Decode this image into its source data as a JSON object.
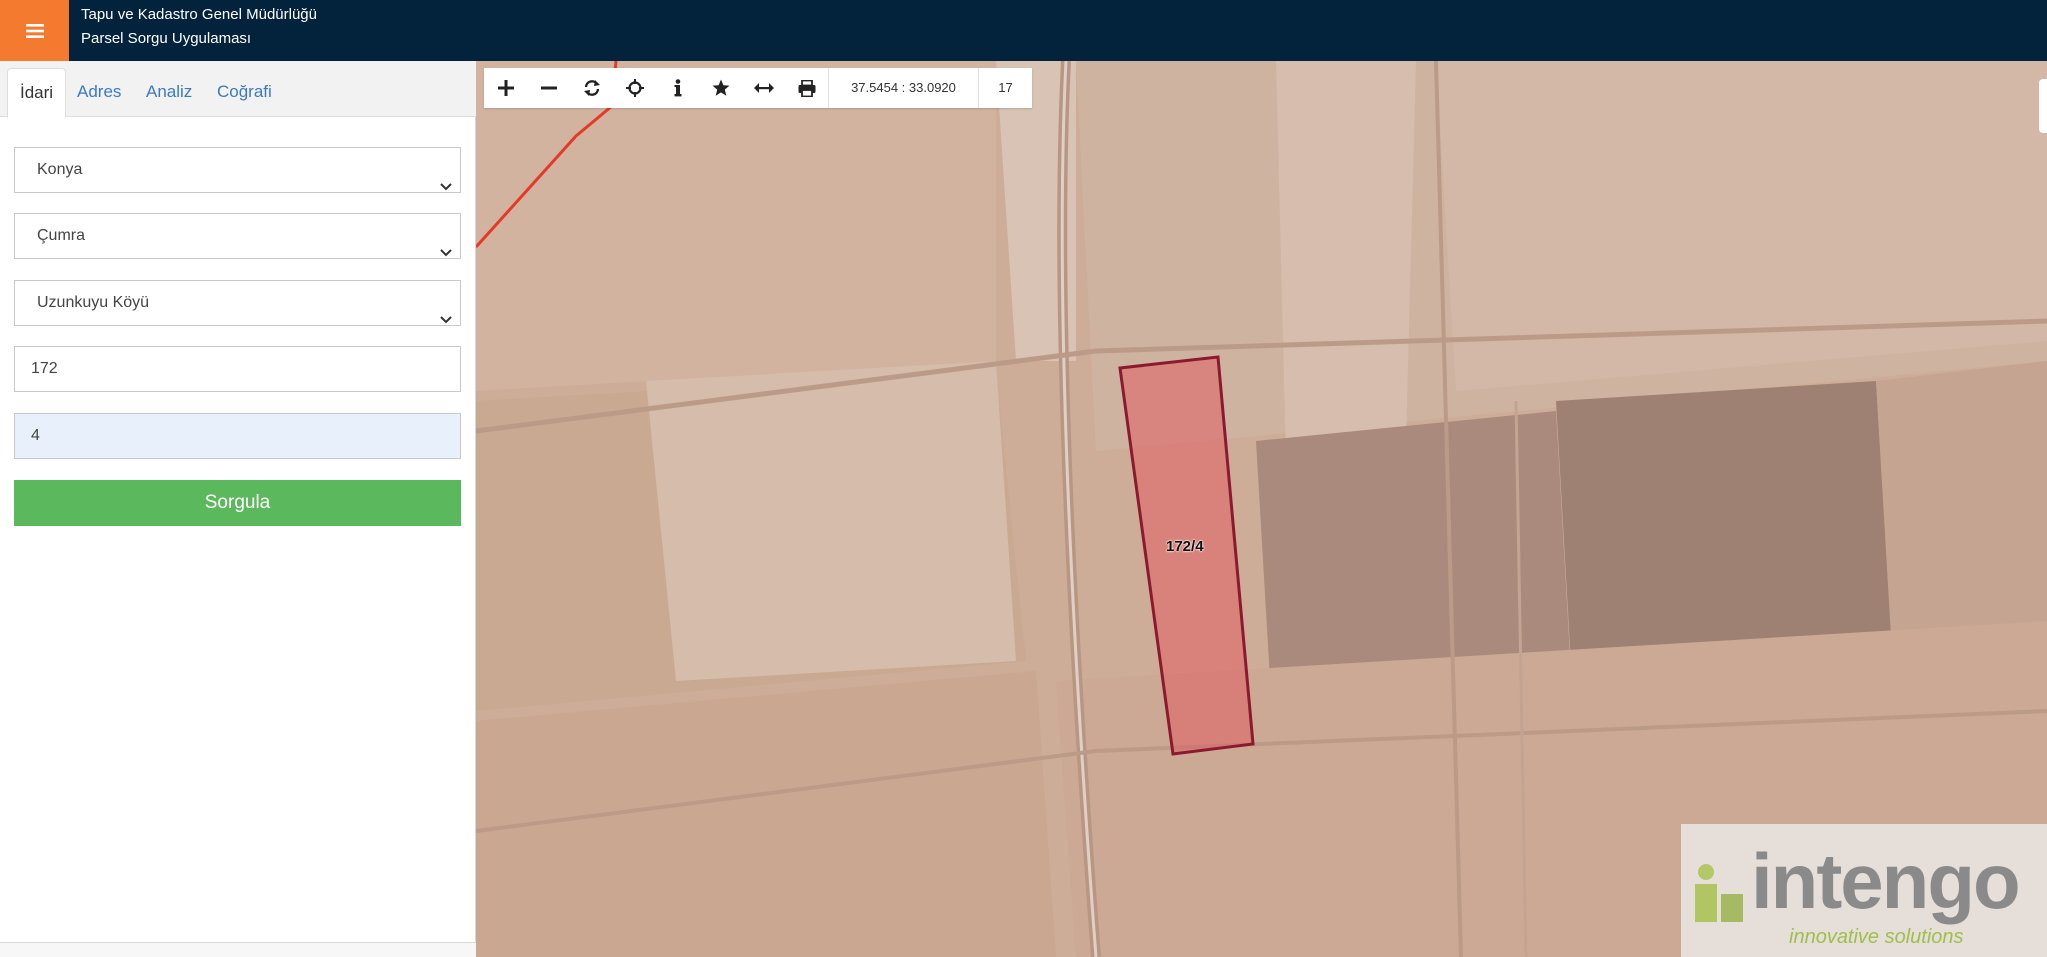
{
  "header": {
    "menu_icon": "hamburger-icon",
    "line1": "Tapu ve Kadastro Genel Müdürlüğü",
    "line2": "Parsel Sorgu Uygulaması",
    "colors": {
      "bar": "#03233d",
      "menu": "#f47a30"
    }
  },
  "sidebar": {
    "tabs": [
      "İdari",
      "Adres",
      "Analiz",
      "Coğrafi"
    ],
    "active_tab": "İdari",
    "province": "Konya",
    "district": "Çumra",
    "neighborhood": "Uzunkuyu Köyü",
    "block": "172",
    "parcel": "4",
    "query_button": "Sorgula",
    "colors": {
      "button": "#5cb85c"
    }
  },
  "map": {
    "toolbar": {
      "icons": [
        "plus-icon",
        "minus-icon",
        "refresh-icon",
        "crosshair-icon",
        "info-icon",
        "star-icon",
        "measure-icon",
        "print-icon"
      ],
      "coordinates": "37.5454 : 33.0920",
      "zoom_level": "17"
    },
    "parcel_label": "172/4",
    "watermark": {
      "brand": "intengo",
      "tagline": "innovative solutions"
    }
  }
}
